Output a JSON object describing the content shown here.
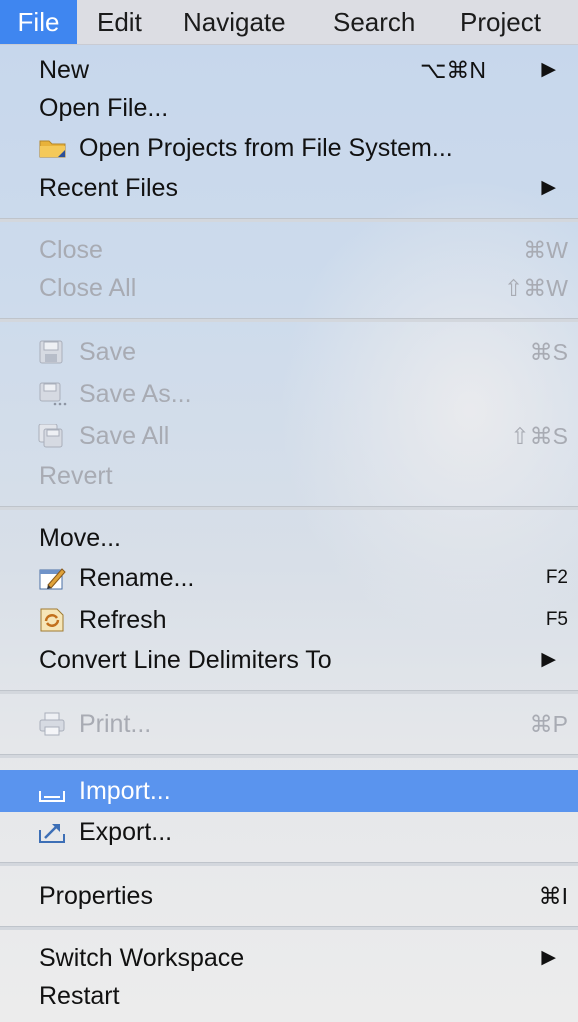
{
  "menubar": {
    "items": [
      {
        "label": "File",
        "active": true
      },
      {
        "label": "Edit"
      },
      {
        "label": "Navigate"
      },
      {
        "label": "Search"
      },
      {
        "label": "Project"
      }
    ]
  },
  "menu": {
    "items": [
      {
        "label": "New",
        "shortcut": "⌥⌘N",
        "submenu": true
      },
      {
        "label": "Open File..."
      },
      {
        "label": "Open Projects from File System...",
        "icon": "folder-icon"
      },
      {
        "label": "Recent Files",
        "submenu": true
      },
      {
        "label": "Close",
        "shortcut": "⌘W",
        "disabled": true
      },
      {
        "label": "Close All",
        "shortcut": "⇧⌘W",
        "disabled": true
      },
      {
        "label": "Save",
        "shortcut": "⌘S",
        "disabled": true,
        "icon": "save-icon"
      },
      {
        "label": "Save As...",
        "disabled": true,
        "icon": "save-as-icon"
      },
      {
        "label": "Save All",
        "shortcut": "⇧⌘S",
        "disabled": true,
        "icon": "save-all-icon"
      },
      {
        "label": "Revert",
        "disabled": true
      },
      {
        "label": "Move..."
      },
      {
        "label": "Rename...",
        "shortcut": "F2",
        "icon": "rename-icon"
      },
      {
        "label": "Refresh",
        "shortcut": "F5",
        "icon": "refresh-icon"
      },
      {
        "label": "Convert Line Delimiters To",
        "submenu": true
      },
      {
        "label": "Print...",
        "shortcut": "⌘P",
        "disabled": true,
        "icon": "print-icon"
      },
      {
        "label": "Import...",
        "highlighted": true,
        "icon": "import-icon"
      },
      {
        "label": "Export...",
        "icon": "export-icon"
      },
      {
        "label": "Properties",
        "shortcut": "⌘I"
      },
      {
        "label": "Switch Workspace",
        "submenu": true
      },
      {
        "label": "Restart"
      }
    ],
    "submenu_arrow": "▶"
  },
  "colors": {
    "highlight": "#5a94ee",
    "active_menu": "#3f86f0",
    "disabled_text": "#a8abb3"
  }
}
